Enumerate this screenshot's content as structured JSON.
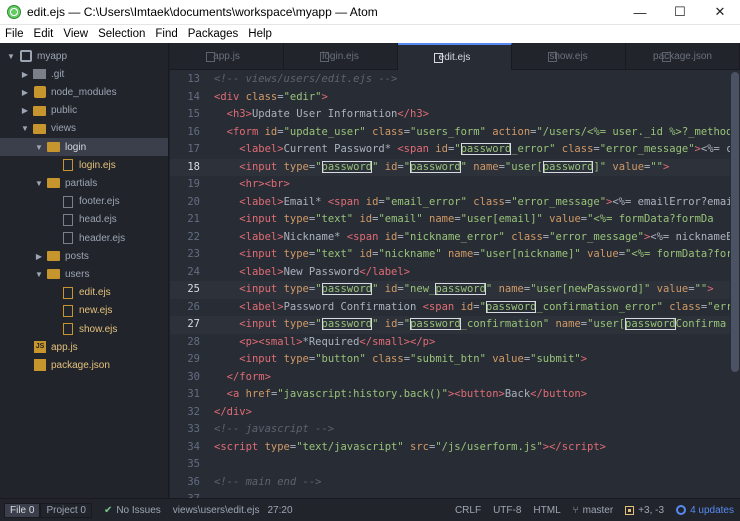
{
  "window": {
    "title": "edit.ejs — C:\\Users\\Imtaek\\documents\\workspace\\myapp — Atom",
    "minimize": "—",
    "maximize": "☐",
    "close": "✕"
  },
  "menu": [
    "File",
    "Edit",
    "View",
    "Selection",
    "Find",
    "Packages",
    "Help"
  ],
  "tree": [
    {
      "label": "myapp",
      "depth": 0,
      "kind": "repo",
      "open": true
    },
    {
      "label": ".git",
      "depth": 1,
      "kind": "folder-gray",
      "open": false
    },
    {
      "label": "node_modules",
      "depth": 1,
      "kind": "package",
      "open": false
    },
    {
      "label": "public",
      "depth": 1,
      "kind": "folder",
      "open": false
    },
    {
      "label": "views",
      "depth": 1,
      "kind": "folder",
      "open": true
    },
    {
      "label": "login",
      "depth": 2,
      "kind": "folder",
      "open": true,
      "selected": true
    },
    {
      "label": "login.ejs",
      "depth": 3,
      "kind": "file"
    },
    {
      "label": "partials",
      "depth": 2,
      "kind": "folder",
      "open": true
    },
    {
      "label": "footer.ejs",
      "depth": 3,
      "kind": "file-gray"
    },
    {
      "label": "head.ejs",
      "depth": 3,
      "kind": "file-gray"
    },
    {
      "label": "header.ejs",
      "depth": 3,
      "kind": "file-gray"
    },
    {
      "label": "posts",
      "depth": 2,
      "kind": "folder",
      "open": false
    },
    {
      "label": "users",
      "depth": 2,
      "kind": "folder",
      "open": true
    },
    {
      "label": "edit.ejs",
      "depth": 3,
      "kind": "file"
    },
    {
      "label": "new.ejs",
      "depth": 3,
      "kind": "file"
    },
    {
      "label": "show.ejs",
      "depth": 3,
      "kind": "file"
    },
    {
      "label": "app.js",
      "depth": 1,
      "kind": "js"
    },
    {
      "label": "package.json",
      "depth": 1,
      "kind": "json"
    }
  ],
  "tabs": [
    {
      "label": "app.js",
      "active": false
    },
    {
      "label": "login.ejs",
      "active": false
    },
    {
      "label": "edit.ejs",
      "active": true
    },
    {
      "label": "show.ejs",
      "active": false
    },
    {
      "label": "package.json",
      "active": false
    }
  ],
  "editor": {
    "line_numbers": [
      "13",
      "14",
      "15",
      "16",
      "17",
      "18",
      "19",
      "20",
      "21",
      "22",
      "23",
      "24",
      "25",
      "26",
      "27",
      "28",
      "29",
      "30",
      "31",
      "32",
      "33",
      "34",
      "35",
      "36",
      "37"
    ],
    "highlighted_lines": [
      "18",
      "25",
      "27"
    ]
  },
  "status": {
    "file_btn": "File",
    "file_count": "0",
    "project_btn": "Project",
    "project_count": "0",
    "issues": "No Issues",
    "path": "views\\users\\edit.ejs",
    "cursor": "27:20",
    "line_ending": "CRLF",
    "encoding": "UTF-8",
    "grammar": "HTML",
    "branch": "master",
    "diff": "+3, -3",
    "updates": "4 updates"
  }
}
